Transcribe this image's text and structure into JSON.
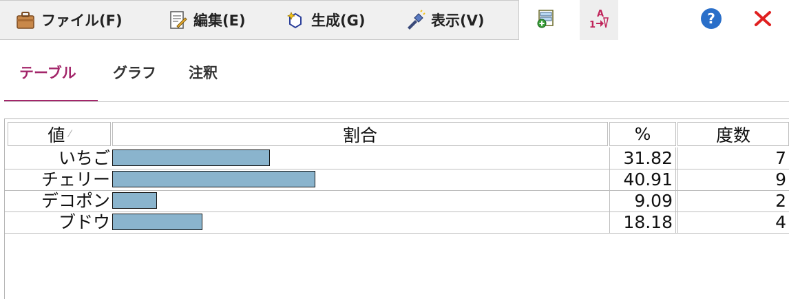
{
  "menu": [
    {
      "label": "ファイル(F)",
      "icon": "briefcase-icon"
    },
    {
      "label": "編集(E)",
      "icon": "edit-document-icon"
    },
    {
      "label": "生成(G)",
      "icon": "sparkle-generate-icon"
    },
    {
      "label": "表示(V)",
      "icon": "flashlight-icon"
    }
  ],
  "tools": {
    "add_icon": "add-table-icon",
    "sort_icon": "sort-az-icon",
    "help_icon": "help-icon",
    "close_icon": "close-icon"
  },
  "tabs": [
    {
      "label": "テーブル",
      "active": true
    },
    {
      "label": "グラフ",
      "active": false
    },
    {
      "label": "注釈",
      "active": false
    }
  ],
  "table": {
    "headers": {
      "value": "値",
      "ratio": "割合",
      "pct": "%",
      "freq": "度数"
    },
    "rows": [
      {
        "label": "いちご",
        "pct": "31.82",
        "freq": "7",
        "ratio": 0.3182
      },
      {
        "label": "チェリー",
        "pct": "40.91",
        "freq": "9",
        "ratio": 0.4091
      },
      {
        "label": "デコポン",
        "pct": "9.09",
        "freq": "2",
        "ratio": 0.0909
      },
      {
        "label": "ブドウ",
        "pct": "18.18",
        "freq": "4",
        "ratio": 0.1818
      }
    ]
  },
  "colors": {
    "accent": "#a3266a",
    "bar_fill": "#8ab4cd",
    "close": "#e02020",
    "help": "#2a6fc9"
  }
}
